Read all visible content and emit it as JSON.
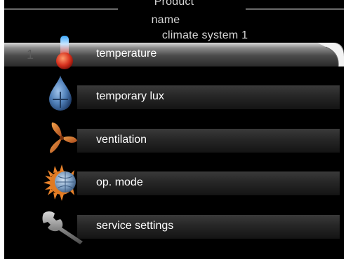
{
  "header": {
    "line1": "Product",
    "line2": "name",
    "line3": "climate system 1"
  },
  "menu": {
    "selected_index": "1",
    "items": [
      {
        "label": "temperature",
        "icon": "thermometer-icon"
      },
      {
        "label": "temporary lux",
        "icon": "water-drop-icon"
      },
      {
        "label": "ventilation",
        "icon": "fan-icon"
      },
      {
        "label": "op. mode",
        "icon": "sun-globe-icon"
      },
      {
        "label": "service settings",
        "icon": "wrench-icon"
      }
    ]
  }
}
